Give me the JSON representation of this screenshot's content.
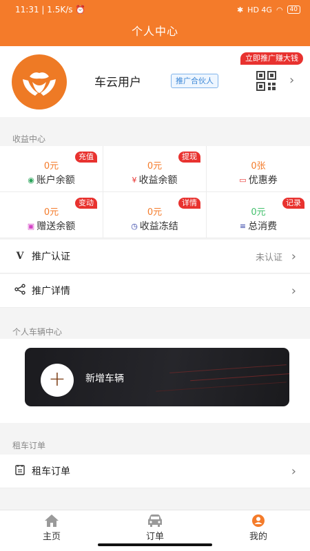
{
  "status_bar": {
    "time": "11:31",
    "network_speed": "1.5K/s",
    "signal": "HD 4G",
    "battery": "40"
  },
  "header": {
    "title": "个人中心"
  },
  "profile": {
    "username": "车云用户",
    "partner_tag": "推广合伙人",
    "promo_badge": "立即推广赚大钱"
  },
  "earnings": {
    "label": "收益中心",
    "items": [
      {
        "value": "0元",
        "label": "账户余额",
        "badge": "充值",
        "icon": "wallet-icon"
      },
      {
        "value": "0元",
        "label": "收益余额",
        "badge": "提现",
        "icon": "yen-icon"
      },
      {
        "value": "0张",
        "label": "优惠券",
        "badge": "",
        "icon": "coupon-icon"
      },
      {
        "value": "0元",
        "label": "赠送余额",
        "badge": "变动",
        "icon": "gift-icon"
      },
      {
        "value": "0元",
        "label": "收益冻结",
        "badge": "详情",
        "icon": "clock-icon"
      },
      {
        "value": "0元",
        "label": "总消费",
        "badge": "记录",
        "icon": "list-icon"
      }
    ]
  },
  "menu": {
    "verify": {
      "label": "推广认证",
      "status": "未认证"
    },
    "details": {
      "label": "推广详情"
    }
  },
  "vehicle": {
    "label": "个人车辆中心",
    "add_label": "新增车辆"
  },
  "rental": {
    "label": "租车订单",
    "row_label": "租车订单"
  },
  "nav": {
    "items": [
      {
        "label": "主页",
        "icon": "home-icon"
      },
      {
        "label": "订单",
        "icon": "car-icon"
      },
      {
        "label": "我的",
        "icon": "user-icon",
        "active": true
      }
    ]
  },
  "colors": {
    "brand": "#f47b2a",
    "badge": "#e8322f",
    "green": "#42c06c"
  }
}
